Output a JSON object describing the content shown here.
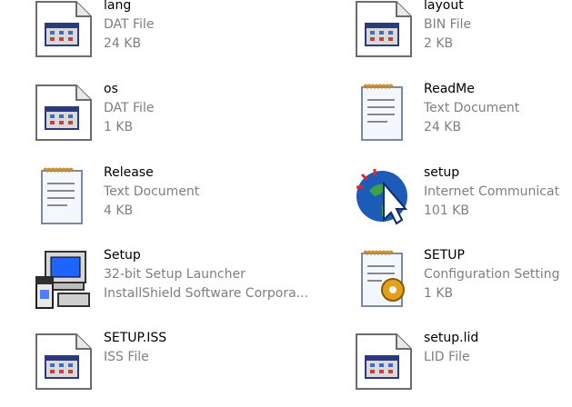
{
  "files": [
    {
      "name": "lang",
      "type": "DAT File",
      "detail": "24 KB",
      "icon": "dat-file-icon"
    },
    {
      "name": "layout",
      "type": "BIN File",
      "detail": "2 KB",
      "icon": "bin-file-icon"
    },
    {
      "name": "os",
      "type": "DAT File",
      "detail": "1 KB",
      "icon": "dat-file-icon"
    },
    {
      "name": "ReadMe",
      "type": "Text Document",
      "detail": "24 KB",
      "icon": "text-document-icon"
    },
    {
      "name": "Release",
      "type": "Text Document",
      "detail": "4 KB",
      "icon": "text-document-icon"
    },
    {
      "name": "setup",
      "type": "Internet Communicat",
      "detail": "101 KB",
      "icon": "internet-shortcut-icon"
    },
    {
      "name": "Setup",
      "type": "32-bit Setup Launcher",
      "detail": "InstallShield Software Corpora...",
      "icon": "setup-launcher-icon"
    },
    {
      "name": "SETUP",
      "type": "Configuration Setting",
      "detail": "1 KB",
      "icon": "config-settings-icon"
    },
    {
      "name": "SETUP.ISS",
      "type": "ISS File",
      "detail": "",
      "icon": "iss-file-icon"
    },
    {
      "name": "setup.lid",
      "type": "LID File",
      "detail": "",
      "icon": "lid-file-icon"
    }
  ]
}
